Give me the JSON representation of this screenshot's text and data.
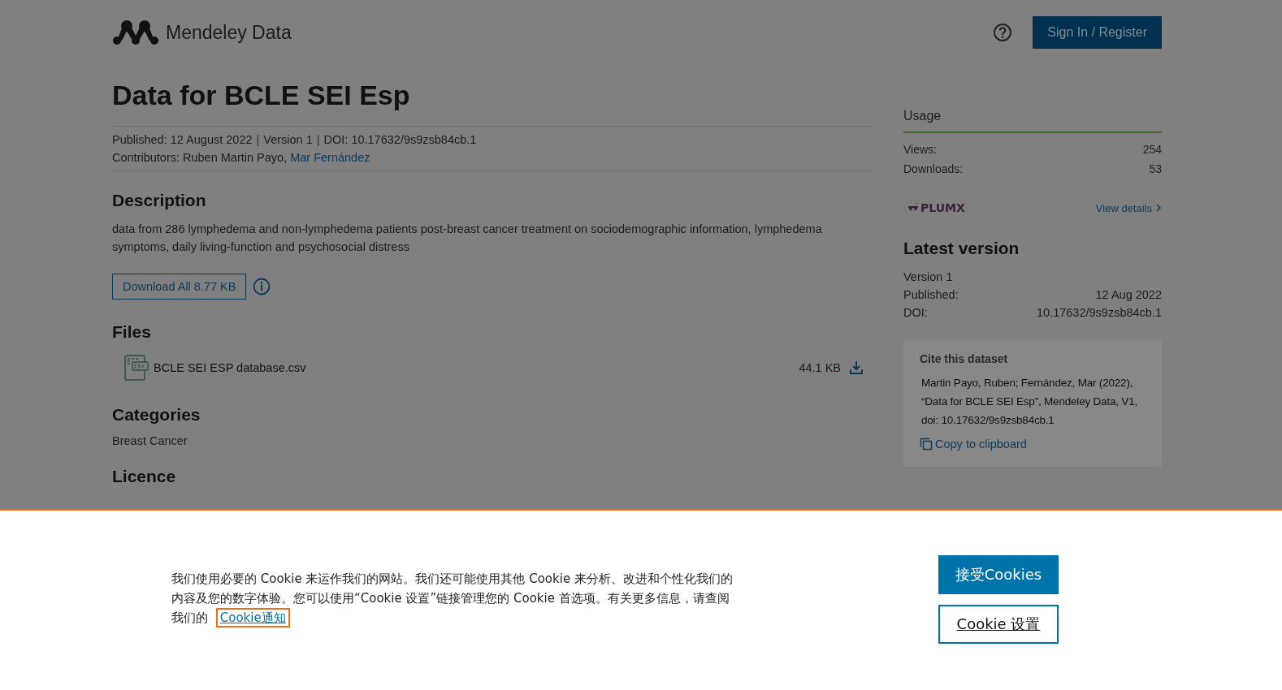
{
  "header": {
    "brand": "Mendeley Data",
    "sign_in": "Sign In / Register"
  },
  "dataset": {
    "title": "Data for BCLE SEI Esp",
    "meta": [
      "Published: 12 August 2022",
      "Version 1",
      "DOI: 10.17632/9s9zsb84cb.1"
    ],
    "meta_separator": "|",
    "contributors_label": "Contributors:",
    "contributors": [
      {
        "name": "Ruben Martin Payo,",
        "link": false
      },
      {
        "name": "Mar Fernández",
        "link": true
      }
    ]
  },
  "description": {
    "heading": "Description",
    "text": "data from 286 lymphedema and non-lymphedema patients post-breast cancer treatment on sociodemographic information, lymphedema symptoms, daily living-function and psychosocial distress",
    "download_button": "Download All 8.77 KB"
  },
  "files": {
    "heading": "Files",
    "items": [
      {
        "name": "BCLE SEI ESP database.csv",
        "size": "44.1 KB"
      }
    ]
  },
  "categories": {
    "heading": "Categories",
    "items": [
      "Breast Cancer"
    ]
  },
  "licence": {
    "heading": "Licence"
  },
  "usage": {
    "heading": "Usage",
    "rows": [
      {
        "label": "Views:",
        "value": "254"
      },
      {
        "label": "Downloads:",
        "value": "53"
      }
    ],
    "plumx": "PLUMX",
    "view_details": "View details"
  },
  "latest_version": {
    "heading": "Latest version",
    "version": "Version 1",
    "rows": [
      {
        "label": "Published:",
        "value": "12 Aug 2022"
      },
      {
        "label": "DOI:",
        "value": "10.17632/9s9zsb84cb.1"
      }
    ]
  },
  "cite": {
    "heading": "Cite this dataset",
    "text": "Martin Payo, Ruben; Fernández, Mar (2022), “Data for BCLE SEI Esp”, Mendeley Data, V1, doi: 10.17632/9s9zsb84cb.1",
    "copy": "Copy to clipboard"
  },
  "cookie_banner": {
    "text": "我们使用必要的 Cookie 来运作我们的网站。我们还可能使用其他 Cookie 来分析、改进和个性化我们的内容及您的数字体验。您可以使用“Cookie 设置”链接管理您的 Cookie 首选项。有关更多信息，请查阅我们的",
    "link": "Cookie通知",
    "accept": "接受Cookies",
    "settings": "Cookie 设置"
  }
}
